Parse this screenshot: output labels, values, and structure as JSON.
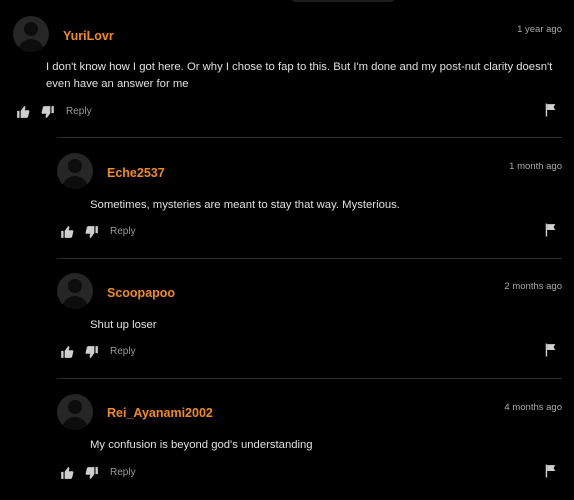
{
  "comments": [
    {
      "username": "YuriLovr",
      "time": "1 year ago",
      "text": "I don't know how I got here. Or why I chose to fap to this. But I'm done and my post-nut clarity doesn't even have an answer for me",
      "reply_label": "Reply"
    },
    {
      "username": "Eche2537",
      "time": "1 month ago",
      "text": "Sometimes, mysteries are meant to stay that way. Mysterious.",
      "reply_label": "Reply"
    },
    {
      "username": "Scoopapoo",
      "time": "2 months ago",
      "text": "Shut up loser",
      "reply_label": "Reply"
    },
    {
      "username": "Rei_Ayanami2002",
      "time": "4 months ago",
      "text": "My confusion is beyond god's understanding",
      "reply_label": "Reply"
    }
  ],
  "icons": {
    "like": "thumbs-up-icon",
    "dislike": "thumbs-down-icon",
    "report": "flag-icon",
    "avatar": "default-avatar-icon"
  },
  "colors": {
    "background": "#000000",
    "username": "#f08a24",
    "text": "#e0e0e0",
    "muted": "#a8a8a8"
  }
}
